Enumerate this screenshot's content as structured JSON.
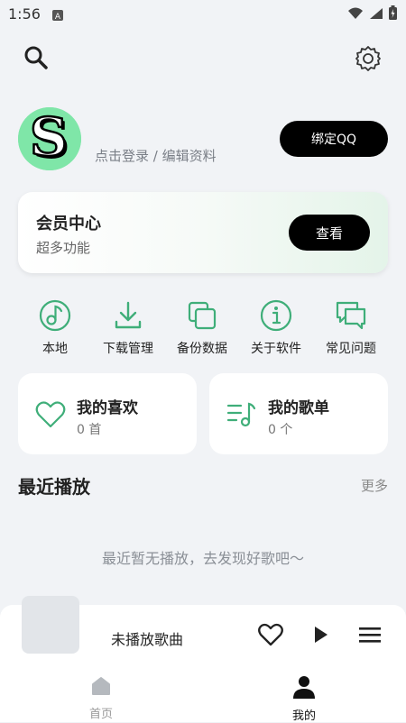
{
  "status_bar": {
    "time": "1:56"
  },
  "header": {
    "search_icon": "search-icon",
    "settings_icon": "gear-icon"
  },
  "profile": {
    "avatar_letter": "S",
    "login_text": "点击登录 / 编辑资料",
    "bind_label": "绑定QQ"
  },
  "vip": {
    "title": "会员中心",
    "subtitle": "超多功能",
    "button": "查看"
  },
  "quick_actions": [
    {
      "label": "本地",
      "icon": "music-note-icon"
    },
    {
      "label": "下载管理",
      "icon": "download-icon"
    },
    {
      "label": "备份数据",
      "icon": "copy-icon"
    },
    {
      "label": "关于软件",
      "icon": "info-icon"
    },
    {
      "label": "常见问题",
      "icon": "chat-icon"
    }
  ],
  "library": {
    "favorites": {
      "title": "我的喜欢",
      "count": "0 首"
    },
    "playlists": {
      "title": "我的歌单",
      "count": "0 个"
    }
  },
  "recent": {
    "title": "最近播放",
    "more": "更多",
    "empty": "最近暂无播放，去发现好歌吧～"
  },
  "player": {
    "song": "未播放歌曲"
  },
  "tabs": [
    {
      "label": "首页",
      "active": false
    },
    {
      "label": "我的",
      "active": true
    }
  ],
  "colors": {
    "accent": "#3fae79",
    "primary_button": "#000000",
    "background": "#f1f3f6"
  }
}
